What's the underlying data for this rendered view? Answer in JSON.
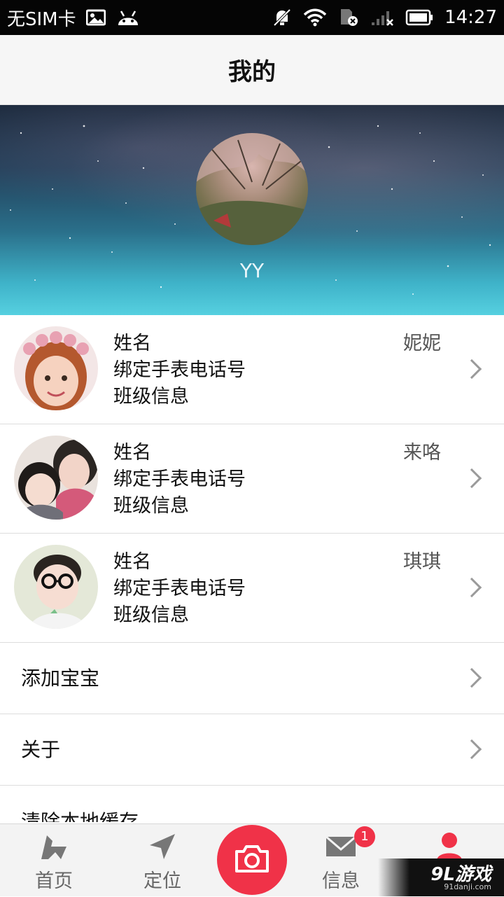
{
  "status_bar": {
    "carrier": "无SIM卡",
    "time": "14:27",
    "icons": [
      "image-icon",
      "android-icon",
      "mute-icon",
      "wifi-icon",
      "sim-error-icon",
      "signal-icon",
      "battery-icon"
    ]
  },
  "header": {
    "title": "我的"
  },
  "profile": {
    "username": "YY"
  },
  "children": [
    {
      "name_label": "姓名",
      "name_value": "妮妮",
      "phone_label": "绑定手表电话号",
      "class_label": "班级信息"
    },
    {
      "name_label": "姓名",
      "name_value": "来咯",
      "phone_label": "绑定手表电话号",
      "class_label": "班级信息"
    },
    {
      "name_label": "姓名",
      "name_value": "琪琪",
      "phone_label": "绑定手表电话号",
      "class_label": "班级信息"
    }
  ],
  "menu": {
    "add_baby": "添加宝宝",
    "about": "关于",
    "clear_cache": "清除本地缓存"
  },
  "bottom_nav": {
    "home": "首页",
    "location": "定位",
    "messages": "信息",
    "message_badge": "1"
  },
  "watermark": {
    "main": "9L游戏",
    "sub": "91danji.com"
  },
  "colors": {
    "accent": "#f03248",
    "title_bar_bg": "#f6f6f6",
    "nav_bg": "#f3f3f3"
  }
}
